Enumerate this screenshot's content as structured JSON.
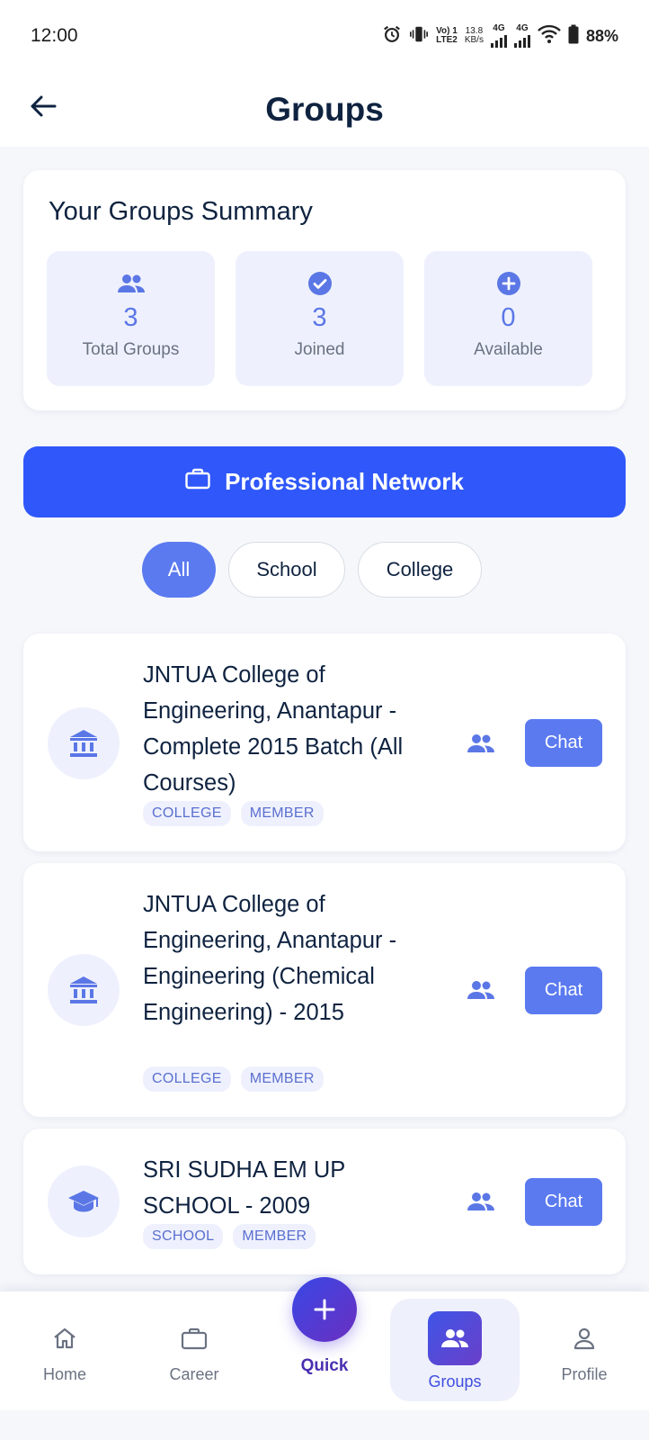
{
  "status_bar": {
    "time": "12:00",
    "volte_top": "Vo) 1",
    "volte_bottom": "LTE2",
    "speed_value": "13.8",
    "speed_unit": "KB/s",
    "net1": "4G",
    "net2": "4G",
    "battery": "88%"
  },
  "header": {
    "title": "Groups"
  },
  "summary": {
    "title": "Your Groups Summary",
    "stats": [
      {
        "value": "3",
        "label": "Total Groups",
        "icon": "group-icon"
      },
      {
        "value": "3",
        "label": "Joined",
        "icon": "check-circle-icon"
      },
      {
        "value": "0",
        "label": "Available",
        "icon": "add-circle-icon"
      }
    ]
  },
  "network_button": {
    "label": "Professional Network",
    "icon": "briefcase-icon"
  },
  "filters": [
    {
      "label": "All",
      "active": true
    },
    {
      "label": "School",
      "active": false
    },
    {
      "label": "College",
      "active": false
    }
  ],
  "groups": [
    {
      "name": "JNTUA College of Engineering, Anantapur - Complete 2015 Batch (All Courses)",
      "tags": [
        "COLLEGE",
        "MEMBER"
      ],
      "icon": "institution-icon",
      "chat_label": "Chat"
    },
    {
      "name": "JNTUA College of Engineering, Anantapur - Engineering (Chemical Engineering) - 2015",
      "tags": [
        "COLLEGE",
        "MEMBER"
      ],
      "icon": "institution-icon",
      "chat_label": "Chat"
    },
    {
      "name": "SRI SUDHA EM UP SCHOOL - 2009",
      "tags": [
        "SCHOOL",
        "MEMBER"
      ],
      "icon": "graduation-cap-icon",
      "chat_label": "Chat"
    }
  ],
  "bottom_nav": {
    "home": "Home",
    "career": "Career",
    "quick": "Quick",
    "groups": "Groups",
    "profile": "Profile",
    "active": "Groups"
  },
  "colors": {
    "accent": "#5b7af0",
    "primary_button": "#2f57fa",
    "title_text": "#0f2340",
    "tint_background": "#eef1fd"
  }
}
